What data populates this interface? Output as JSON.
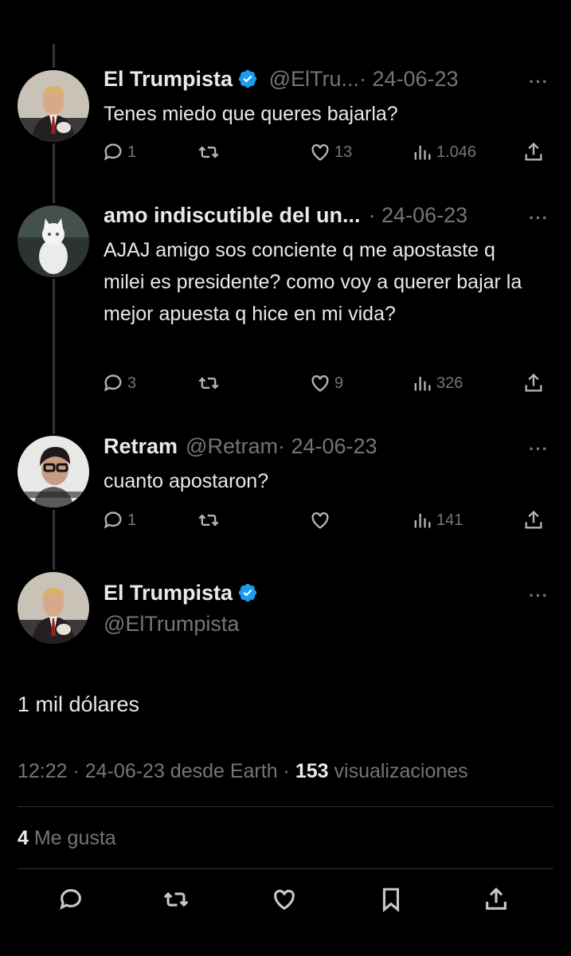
{
  "tweets": [
    {
      "name": "El Trumpista",
      "handle": "@ElTru...",
      "date": "· 24-06-23",
      "text": "Tenes miedo que queres bajarla?",
      "replies": "1",
      "retweets": "",
      "likes": "13",
      "views": "1.046"
    },
    {
      "name": "amo indiscutible del un...",
      "handle": "",
      "date": "· 24-06-23",
      "text": "AJAJ amigo sos conciente q me apostaste q milei es presidente? como voy a querer bajar la mejor apuesta q hice en mi vida?",
      "replies": "3",
      "retweets": "",
      "likes": "9",
      "views": "326"
    },
    {
      "name": "Retram",
      "handle": "@Retram",
      "date": "· 24-06-23",
      "text": "cuanto apostaron?",
      "replies": "1",
      "retweets": "",
      "likes": "",
      "views": "141"
    }
  ],
  "main_tweet": {
    "name": "El Trumpista",
    "handle": "@ElTrumpista",
    "text": "1 mil dólares",
    "time": "12:22 · 24-06-23 desde Earth ·",
    "views_count": "153",
    "views_label": "visualizaciones",
    "likes_count": "4",
    "likes_label": "Me gusta"
  },
  "icons": [
    "more-icon",
    "verified-icon",
    "reply-icon",
    "retweet-icon",
    "like-icon",
    "views-icon",
    "share-icon",
    "bookmark-icon"
  ],
  "colors": {
    "background": "#000000",
    "text": "#e7e9ea",
    "muted": "#71767b",
    "verified": "#1d9bf0"
  }
}
